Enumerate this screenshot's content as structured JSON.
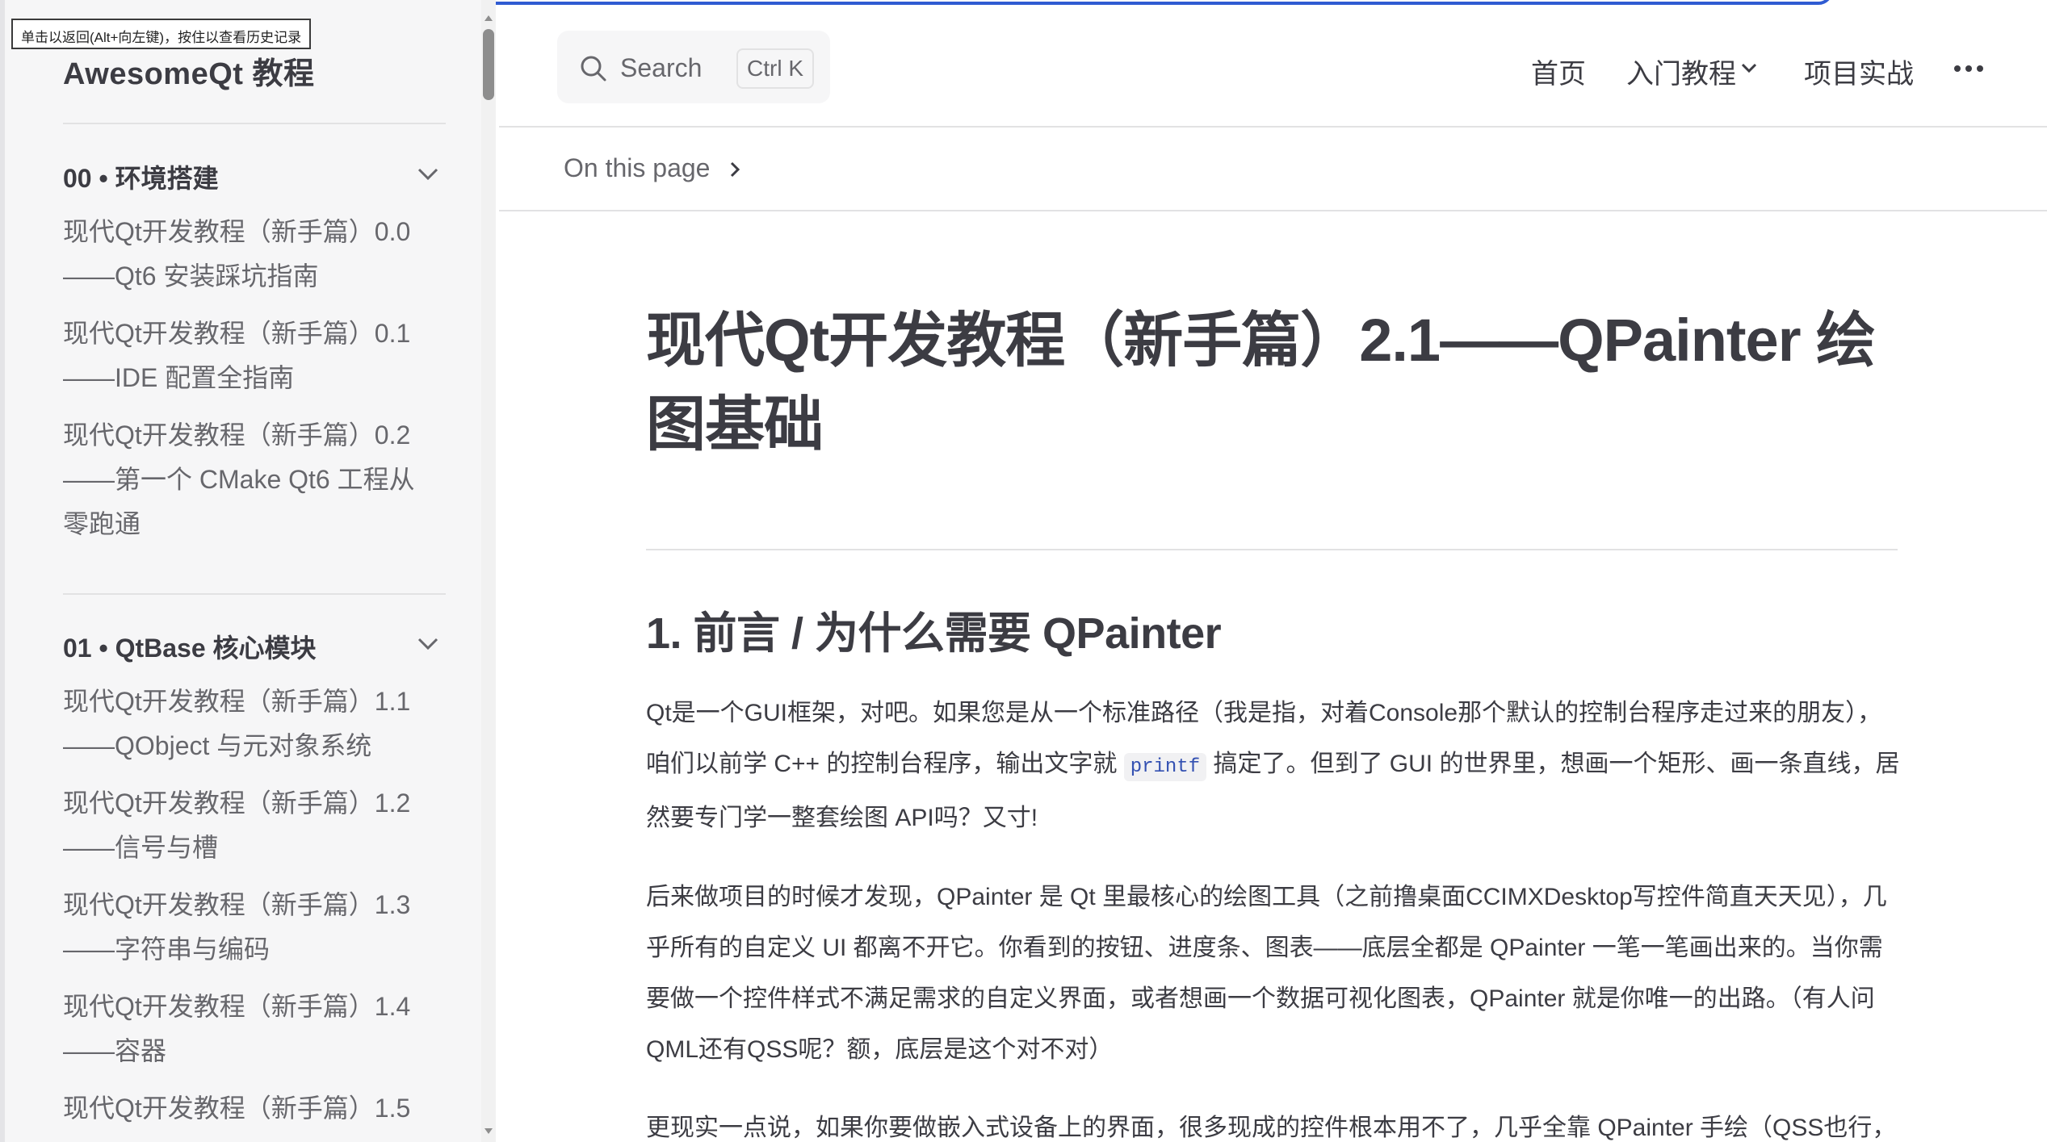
{
  "browser": {
    "back_tooltip": "单击以返回(Alt+向左键)，按住以查看历史记录"
  },
  "sidebar": {
    "title": "AwesomeQt 教程",
    "groups": [
      {
        "title": "00 • 环境搭建",
        "items": [
          "现代Qt开发教程（新手篇）0.0\n——Qt6 安装踩坑指南",
          "现代Qt开发教程（新手篇）0.1\n——IDE 配置全指南",
          "现代Qt开发教程（新手篇）0.2\n——第一个 CMake Qt6 工程从\n零跑通"
        ]
      },
      {
        "title": "01 • QtBase 核心模块",
        "items": [
          "现代Qt开发教程（新手篇）1.1\n——QObject 与元对象系统",
          "现代Qt开发教程（新手篇）1.2\n——信号与槽",
          "现代Qt开发教程（新手篇）1.3\n——字符串与编码",
          "现代Qt开发教程（新手篇）1.4\n——容器",
          "现代Qt开发教程（新手篇）1.5"
        ]
      }
    ]
  },
  "topnav": {
    "search_label": "Search",
    "search_shortcut": "Ctrl K",
    "links": [
      "首页",
      "入门教程",
      "项目实战"
    ],
    "more_icon": "more-horizontal-icon"
  },
  "onpage": {
    "label": "On this page"
  },
  "article": {
    "title": "现代Qt开发教程（新手篇）2.1——QPainter 绘图基础",
    "section_heading": "1. 前言 / 为什么需要 QPainter",
    "p1_a": "Qt是一个GUI框架，对吧。如果您是从一个标准路径（我是指，对着Console那个默认的控制台程序走过来的朋友），咱们以前学 C++ 的控制台程序，输出文字就 ",
    "p1_code": "printf",
    "p1_b": " 搞定了。但到了 GUI 的世界里，想画一个矩形、画一条直线，居然要专门学一整套绘图 API吗？又寸!",
    "p2": "后来做项目的时候才发现，QPainter 是 Qt 里最核心的绘图工具（之前撸桌面CCIMXDesktop写控件简直天天见），几乎所有的自定义 UI 都离不开它。你看到的按钮、进度条、图表——底层全都是 QPainter 一笔一笔画出来的。当你需要做一个控件样式不满足需求的自定义界面，或者想画一个数据可视化图表，QPainter 就是你唯一的出路。（有人问QML还有QSS呢？额，底层是这个对不对）",
    "p3": "更现实一点说，如果你要做嵌入式设备上的界面，很多现成的控件根本用不了，几乎全靠 QPainter 手绘（QSS也行，"
  }
}
